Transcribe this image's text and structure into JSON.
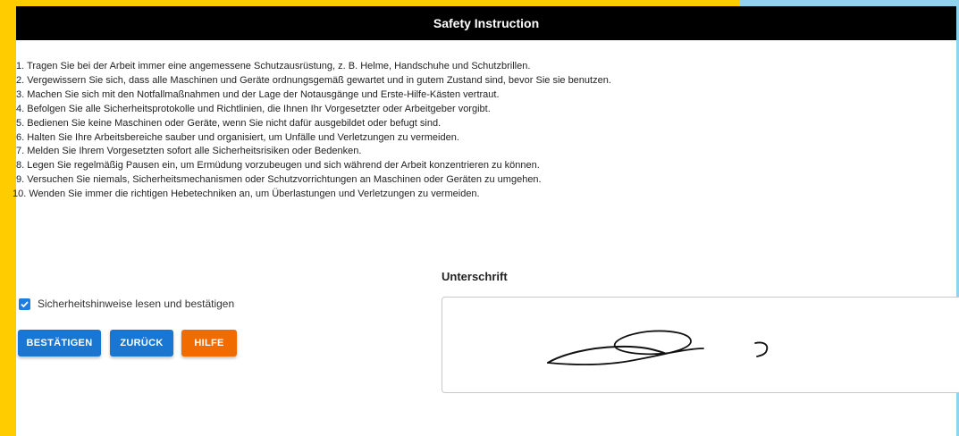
{
  "title": "Safety Instruction",
  "instructions": [
    "1. Tragen Sie bei der Arbeit immer eine angemessene Schutzausrüstung, z. B. Helme, Handschuhe und Schutzbrillen.",
    "2. Vergewissern Sie sich, dass alle Maschinen und Geräte ordnungsgemäß gewartet und in gutem Zustand sind, bevor Sie sie benutzen.",
    "3. Machen Sie sich mit den Notfallmaßnahmen und der Lage der Notausgänge und Erste-Hilfe-Kästen vertraut.",
    "4. Befolgen Sie alle Sicherheitsprotokolle und Richtlinien, die Ihnen Ihr Vorgesetzter oder Arbeitgeber vorgibt.",
    "5. Bedienen Sie keine Maschinen oder Geräte, wenn Sie nicht dafür ausgebildet oder befugt sind.",
    "6. Halten Sie Ihre Arbeitsbereiche sauber und organisiert, um Unfälle und Verletzungen zu vermeiden.",
    "7. Melden Sie Ihrem Vorgesetzten sofort alle Sicherheitsrisiken oder Bedenken.",
    "8. Legen Sie regelmäßig Pausen ein, um Ermüdung vorzubeugen und sich während der Arbeit konzentrieren zu können.",
    "9. Versuchen Sie niemals, Sicherheitsmechanismen oder Schutzvorrichtungen an Maschinen oder Geräten zu umgehen.",
    "10. Wenden Sie immer die richtigen Hebetechniken an, um Überlastungen und Verletzungen zu vermeiden."
  ],
  "checkbox": {
    "label": "Sicherheitshinweise lesen und bestätigen",
    "checked": true
  },
  "buttons": {
    "confirm": "BESTÄTIGEN",
    "back": "ZURÜCK",
    "help": "HILFE"
  },
  "signature": {
    "label": "Unterschrift"
  },
  "colors": {
    "frame_yellow": "#ffcc00",
    "frame_blue": "#8fd3ee",
    "primary": "#1976d2",
    "help": "#f06c00"
  }
}
